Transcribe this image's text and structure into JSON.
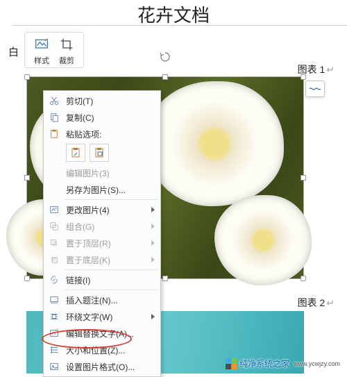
{
  "page": {
    "title": "花卉文档"
  },
  "ribbon": {
    "left_label": "白",
    "style_label": "样式",
    "crop_label": "裁剪"
  },
  "captions": {
    "label1": "图表 1",
    "label2": "图表 2"
  },
  "context_menu": {
    "cut": "剪切(T)",
    "copy": "复制(C)",
    "paste_options": "粘贴选项:",
    "edit_picture": "编辑图片(3)",
    "save_as_picture": "另存为图片(S)...",
    "change_picture": "更改图片(4)",
    "group": "组合(G)",
    "bring_to_front": "置于顶层(R)",
    "send_to_back": "置于底层(K)",
    "hyperlink": "链接(I)",
    "insert_caption": "插入题注(N)...",
    "wrap_text": "环绕文字(W)",
    "edit_alt_text": "编辑替换文字(A)...",
    "size_and_position": "大小和位置(Z)...",
    "format_picture": "设置图片格式(O)..."
  },
  "watermark": {
    "text": "纯净系统之家",
    "url": "www.ycwjzy.com"
  }
}
